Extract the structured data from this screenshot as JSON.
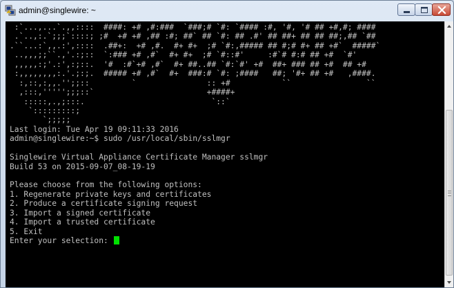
{
  "window": {
    "title": "admin@singlewire: ~"
  },
  "terminal": {
    "lines": [
      " :`...,...`.,,::::  ####: +# ,#:###  `###;# `#: `#### :#, '#, '# ## +#,#; ####",
      " .`..,:.`;;;`::::; ;#  +# +# ,## :#; ##` ## `#: ## .#' ## ##+ ## ## ##;,## `##",
      ".``...:`,,.:',::::  .##+:  +# ,#.  #+ #+  ;# `#:,##### ## #;# #+ ## +#`  #####`",
      " ..,,,;;``.,'.:;::  `:### +# ,#`  #+ #+  ;# `#::#'     :#`# #:# ## +#  `#'",
      " ,,,,,:;'.:',:;::.  '#  :#`+# ,#`  #+ ##..## `#:`#' +#  ##+ ### ## +#  ## +#",
      " :,,,,,,,,:.'.;:;.  ##### +# ,#`  #+  ###:# `#: ;####   ##; '#+ ## +#   ,####.",
      "  :,::,:,,.'';;::         `               :: +#           ``                ``",
      "  ,:::,''''';;;::`                        +####+",
      "   :::::,.,;:::.                           `::`",
      "    `:::::::::;",
      "       `;;;;;",
      "Last login: Tue Apr 19 09:11:33 2016",
      "admin@singlewire:~$ sudo /usr/local/sbin/sslmgr",
      "",
      "Singlewire Virtual Appliance Certificate Manager sslmgr",
      "Build 53 on 2015-09-07_08-19-19",
      "",
      "Please choose from the following options:",
      "1. Regenerate private keys and certificates",
      "2. Produce a certificate signing request",
      "3. Import a signed certificate",
      "4. Import a trusted certificate",
      "5. Exit",
      "Enter your selection: "
    ]
  },
  "colors": {
    "terminal_background": "#000000",
    "terminal_text": "#c0c0c0",
    "cursor": "#00e000",
    "close_button": "#c84a35"
  },
  "icons": {
    "app": "putty-icon",
    "minimize": "minimize-icon",
    "maximize": "maximize-icon",
    "close": "close-icon",
    "scroll_up": "arrow-up-icon",
    "scroll_down": "arrow-down-icon"
  }
}
